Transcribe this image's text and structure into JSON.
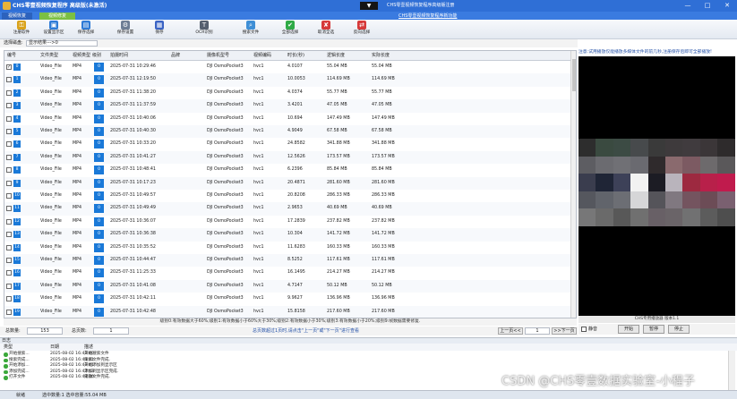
{
  "window": {
    "title": "CHS零壹视频恢复程序 高级版(未激活)",
    "collapse_glyph": "▼",
    "register_link": "CHS零壹视频恢复程序高级版注册",
    "min_glyph": "—",
    "max_glyph": "□",
    "close_glyph": "✕"
  },
  "tabs": {
    "tab1": "视频恢复",
    "tab2": "视频修复",
    "link": "CHS零壹视频恢复程序新功能"
  },
  "toolbar": {
    "items": [
      {
        "label": "注册软件",
        "icon": "key-icon",
        "glyph": "⚿",
        "color": "#d9a21b"
      },
      {
        "label": "设置显示区",
        "icon": "display-icon",
        "glyph": "▣",
        "color": "#2e7bd6"
      },
      {
        "label": "保存选择",
        "icon": "save-icon",
        "glyph": "▤",
        "color": "#2e7bd6"
      },
      {
        "label": "保存设置",
        "icon": "settings-icon",
        "glyph": "⚙",
        "color": "#6d7d94"
      },
      {
        "label": "保存",
        "icon": "floppy-icon",
        "glyph": "▦",
        "color": "#3a63c4"
      },
      {
        "label": "OCR识别",
        "icon": "ocr-icon",
        "glyph": "T",
        "color": "#555f6e"
      },
      {
        "label": "搜索文件",
        "icon": "search-icon",
        "glyph": "⌕",
        "color": "#3f8fd6"
      },
      {
        "label": "全部选择",
        "icon": "check-all-icon",
        "glyph": "✔",
        "color": "#2faa46"
      },
      {
        "label": "取消全选",
        "icon": "uncheck-all-icon",
        "glyph": "✘",
        "color": "#d63a3a"
      },
      {
        "label": "反向选择",
        "icon": "invert-select-icon",
        "glyph": "⇄",
        "color": "#d63a3a"
      }
    ]
  },
  "path": {
    "label": "选择磁盘:",
    "value": "显示结果--->0"
  },
  "table": {
    "columns": [
      "编号",
      "文件类型",
      "视频类型",
      "级别",
      "拍摄时间",
      "品牌",
      "摄像机型号",
      "视频编码",
      "时长(秒)",
      "逻辑长度",
      "实际长度"
    ],
    "rows": [
      {
        "id": "0",
        "ftype": "Video_File",
        "vtype": "MP4",
        "level": "0",
        "time": "2025-07-31 10:29:46",
        "brand": "",
        "model": "DJI OsmoPocket3",
        "codec": "hvc1",
        "dur": "4.0107",
        "logical": "55.04 MB",
        "actual": "55.04 MB",
        "checked": true
      },
      {
        "id": "1",
        "ftype": "Video_File",
        "vtype": "MP4",
        "level": "0",
        "time": "2025-07-31 12:19:50",
        "brand": "",
        "model": "DJI OsmoPocket3",
        "codec": "hvc1",
        "dur": "10.0053",
        "logical": "114.69 MB",
        "actual": "114.69 MB",
        "checked": false
      },
      {
        "id": "2",
        "ftype": "Video_File",
        "vtype": "MP4",
        "level": "0",
        "time": "2025-07-31 11:38:20",
        "brand": "",
        "model": "DJI OsmoPocket3",
        "codec": "hvc1",
        "dur": "4.0374",
        "logical": "55.77 MB",
        "actual": "55.77 MB",
        "checked": false
      },
      {
        "id": "3",
        "ftype": "Video_File",
        "vtype": "MP4",
        "level": "0",
        "time": "2025-07-31 11:37:59",
        "brand": "",
        "model": "DJI OsmoPocket3",
        "codec": "hvc1",
        "dur": "3.4201",
        "logical": "47.05 MB",
        "actual": "47.05 MB",
        "checked": false
      },
      {
        "id": "4",
        "ftype": "Video_File",
        "vtype": "MP4",
        "level": "0",
        "time": "2025-07-31 10:40:06",
        "brand": "",
        "model": "DJI OsmoPocket3",
        "codec": "hvc1",
        "dur": "10.694",
        "logical": "147.49 MB",
        "actual": "147.49 MB",
        "checked": false
      },
      {
        "id": "5",
        "ftype": "Video_File",
        "vtype": "MP4",
        "level": "0",
        "time": "2025-07-31 10:40:30",
        "brand": "",
        "model": "DJI OsmoPocket3",
        "codec": "hvc1",
        "dur": "4.9049",
        "logical": "67.58 MB",
        "actual": "67.58 MB",
        "checked": false
      },
      {
        "id": "6",
        "ftype": "Video_File",
        "vtype": "MP4",
        "level": "0",
        "time": "2025-07-31 10:33:20",
        "brand": "",
        "model": "DJI OsmoPocket3",
        "codec": "hvc1",
        "dur": "24.8582",
        "logical": "341.88 MB",
        "actual": "341.88 MB",
        "checked": false
      },
      {
        "id": "7",
        "ftype": "Video_File",
        "vtype": "MP4",
        "level": "0",
        "time": "2025-07-31 10:41:27",
        "brand": "",
        "model": "DJI OsmoPocket3",
        "codec": "hvc1",
        "dur": "12.5626",
        "logical": "173.57 MB",
        "actual": "173.57 MB",
        "checked": false
      },
      {
        "id": "8",
        "ftype": "Video_File",
        "vtype": "MP4",
        "level": "0",
        "time": "2025-07-31 10:48:41",
        "brand": "",
        "model": "DJI OsmoPocket3",
        "codec": "hvc1",
        "dur": "6.2396",
        "logical": "85.84 MB",
        "actual": "85.84 MB",
        "checked": false
      },
      {
        "id": "9",
        "ftype": "Video_File",
        "vtype": "MP4",
        "level": "0",
        "time": "2025-07-31 10:17:23",
        "brand": "",
        "model": "DJI OsmoPocket3",
        "codec": "hvc1",
        "dur": "20.4871",
        "logical": "281.60 MB",
        "actual": "281.60 MB",
        "checked": false
      },
      {
        "id": "10",
        "ftype": "Video_File",
        "vtype": "MP4",
        "level": "0",
        "time": "2025-07-31 10:49:57",
        "brand": "",
        "model": "DJI OsmoPocket3",
        "codec": "hvc1",
        "dur": "20.8208",
        "logical": "286.33 MB",
        "actual": "286.33 MB",
        "checked": false
      },
      {
        "id": "11",
        "ftype": "Video_File",
        "vtype": "MP4",
        "level": "0",
        "time": "2025-07-31 10:49:49",
        "brand": "",
        "model": "DJI OsmoPocket3",
        "codec": "hvc1",
        "dur": "2.9653",
        "logical": "40.69 MB",
        "actual": "40.69 MB",
        "checked": false
      },
      {
        "id": "12",
        "ftype": "Video_File",
        "vtype": "MP4",
        "level": "0",
        "time": "2025-07-31 10:36:07",
        "brand": "",
        "model": "DJI OsmoPocket3",
        "codec": "hvc1",
        "dur": "17.2839",
        "logical": "237.82 MB",
        "actual": "237.82 MB",
        "checked": false
      },
      {
        "id": "13",
        "ftype": "Video_File",
        "vtype": "MP4",
        "level": "0",
        "time": "2025-07-31 10:36:38",
        "brand": "",
        "model": "DJI OsmoPocket3",
        "codec": "hvc1",
        "dur": "10.304",
        "logical": "141.72 MB",
        "actual": "141.72 MB",
        "checked": false
      },
      {
        "id": "14",
        "ftype": "Video_File",
        "vtype": "MP4",
        "level": "0",
        "time": "2025-07-31 10:35:52",
        "brand": "",
        "model": "DJI OsmoPocket3",
        "codec": "hvc1",
        "dur": "11.6283",
        "logical": "160.33 MB",
        "actual": "160.33 MB",
        "checked": false
      },
      {
        "id": "15",
        "ftype": "Video_File",
        "vtype": "MP4",
        "level": "0",
        "time": "2025-07-31 10:44:47",
        "brand": "",
        "model": "DJI OsmoPocket3",
        "codec": "hvc1",
        "dur": "8.5252",
        "logical": "117.61 MB",
        "actual": "117.61 MB",
        "checked": false
      },
      {
        "id": "16",
        "ftype": "Video_File",
        "vtype": "MP4",
        "level": "0",
        "time": "2025-07-31 11:25:33",
        "brand": "",
        "model": "DJI OsmoPocket3",
        "codec": "hvc1",
        "dur": "16.1495",
        "logical": "214.27 MB",
        "actual": "214.27 MB",
        "checked": false
      },
      {
        "id": "17",
        "ftype": "Video_File",
        "vtype": "MP4",
        "level": "0",
        "time": "2025-07-31 10:41:08",
        "brand": "",
        "model": "DJI OsmoPocket3",
        "codec": "hvc1",
        "dur": "4.7147",
        "logical": "50.12 MB",
        "actual": "50.12 MB",
        "checked": false
      },
      {
        "id": "18",
        "ftype": "Video_File",
        "vtype": "MP4",
        "level": "0",
        "time": "2025-07-31 10:42:11",
        "brand": "",
        "model": "DJI OsmoPocket3",
        "codec": "hvc1",
        "dur": "9.9627",
        "logical": "136.96 MB",
        "actual": "136.96 MB",
        "checked": false
      },
      {
        "id": "19",
        "ftype": "Video_File",
        "vtype": "MP4",
        "level": "0",
        "time": "2025-07-31 10:42:48",
        "brand": "",
        "model": "DJI OsmoPocket3",
        "codec": "hvc1",
        "dur": "15.8158",
        "logical": "217.60 MB",
        "actual": "217.60 MB",
        "checked": false
      }
    ]
  },
  "status_note": "级别0:有效数据大于60%;级别1:有效数据小于60%大于30%;级别2:有效数据小于30%;级别3:有效数据小于20%;级别9:帧数据需要修复.",
  "stats": {
    "total_label": "总数量:",
    "total_value": "153",
    "pages_label": "总页数:",
    "pages_value": "1",
    "page_note": "总页数超过1页时,请点击\"上一页\"或\"下一页\"进行查看",
    "prev": "上一页<<",
    "page_input": "1",
    "next": ">>下一页"
  },
  "preview": {
    "header": "注意:试用播放仅能播放多媒体文件的前几秒,注册保存后即可全部播放!",
    "player_label": "CHS专用播放器 版本1.1",
    "mute_label": "静音",
    "play": "开始",
    "pause": "暂停",
    "stop": "停止"
  },
  "log": {
    "title": "日志",
    "columns": [
      "类型",
      "日期",
      "描述"
    ],
    "rows": [
      {
        "type": "开始搜索...",
        "date": "2025-08-02 16:43:40",
        "desc": "开始搜索文件"
      },
      {
        "type": "搜索完成...",
        "date": "2025-08-02 16:43:41",
        "desc": "搜索文件完成."
      },
      {
        "type": "开始添加...",
        "date": "2025-08-02 16:43:41",
        "desc": "开始添加到显示区"
      },
      {
        "type": "添加完成...",
        "date": "2025-08-02 16:43:43",
        "desc": "添加到显示区完成."
      },
      {
        "type": "打开文件",
        "date": "2025-08-02 16:43:46",
        "desc": "播放文件完成."
      }
    ]
  },
  "statusbar": {
    "label": "就绪",
    "text": "选中数量:1 选中容量:55.04 MB"
  },
  "watermark": "CSDN @CHS零壹数据实验室-小程子",
  "colors": {
    "title_blue": "#2f6fd6",
    "index_blue": "#1a79d8",
    "tab_green": "#7bc043",
    "preview_bg": "#000000"
  }
}
